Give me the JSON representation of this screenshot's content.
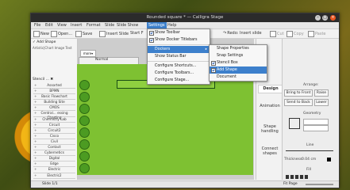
{
  "window": {
    "title": "Rounded square * — Calligra Stage"
  },
  "menubar": [
    "File",
    "Edit",
    "View",
    "Insert",
    "Format",
    "Slide",
    "Slide Show",
    "Settings",
    "Help"
  ],
  "toolbar": {
    "new": "New",
    "open": "Open...",
    "save": "Save",
    "insert_slide": "Insert Slide",
    "start": "Start F",
    "cut": "Cut",
    "copy": "Copy",
    "paste": "Paste",
    "redo": "Redo: Insert slide"
  },
  "left_panel": {
    "add_shape": "Add Shape",
    "filter": "Artistic|Chart Image Text",
    "more": "more▾",
    "stencil": "Stencil ...",
    "tree": [
      "Assorted",
      "BPMN",
      "Basic Flowchart",
      "Building Site",
      "CMOS",
      "Central... essing Charting",
      "Chemistry Lab",
      "Circuit",
      "Circuit2",
      "Cisco",
      "Civil",
      "Contact",
      "Cybernetics",
      "Digital",
      "Edge",
      "Electric",
      "Electric2"
    ]
  },
  "slide": {
    "layout": "Normal",
    "title": "This is t"
  },
  "settings_menu": {
    "items": [
      {
        "label": "Show Toolbar",
        "check": true
      },
      {
        "label": "Show Docker Titlebars",
        "check": true
      },
      {
        "label": "Dockers",
        "highlight": true,
        "submenu": true
      },
      {
        "label": "Show Status Bar",
        "check": false
      },
      {
        "label": "Configure Shortcuts...",
        "check": false
      },
      {
        "label": "Configure Toolbars...",
        "check": false
      },
      {
        "label": "Configure Stage...",
        "check": false
      }
    ]
  },
  "dockers_menu": {
    "items": [
      {
        "label": "Shape Properties",
        "check": false
      },
      {
        "label": "Snap Settings",
        "check": false
      },
      {
        "label": "Stencil Box",
        "check": true
      },
      {
        "label": "Add Shape",
        "check": true,
        "highlight": true
      },
      {
        "label": "Document",
        "check": false
      }
    ]
  },
  "right_tabs": [
    "Design",
    "Animation",
    "Shape handling",
    "Connect shapes"
  ],
  "properties": {
    "arrange": "Arrange:",
    "bring_front": "Bring to Front",
    "raise": "Raise",
    "send_back": "Send to Back",
    "lower": "Lower",
    "geometry": "Geometry",
    "line": "Line",
    "thickness_label": "Thickness:",
    "thickness_value": "0.04 cm",
    "fill": "Fill"
  },
  "statusbar": {
    "slide": "Slide 1/1",
    "zoom": "Fit Page"
  },
  "colors": {
    "accent": "#3d80cc",
    "slide_green": "#7ec132"
  }
}
